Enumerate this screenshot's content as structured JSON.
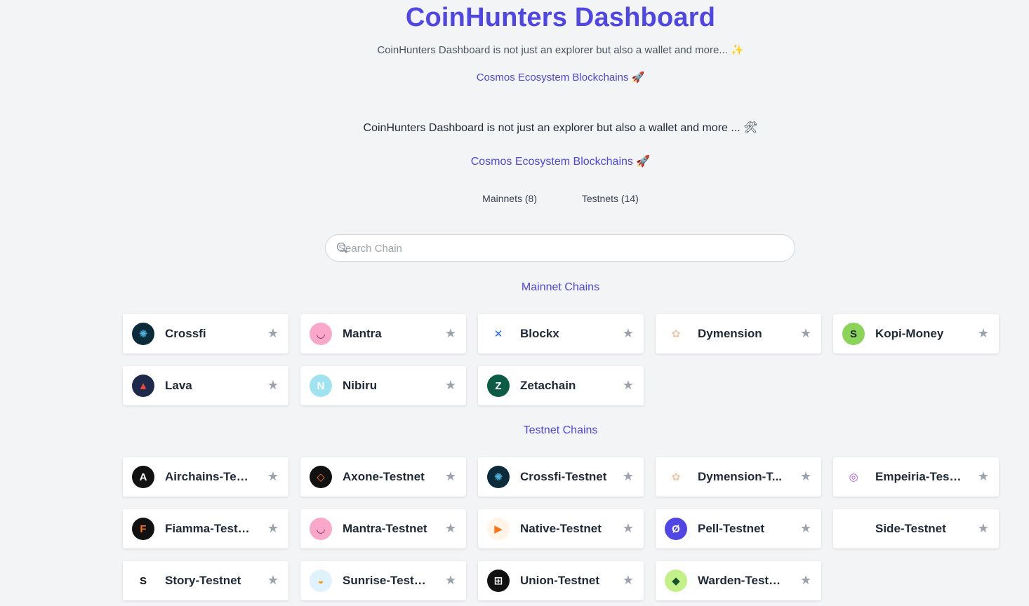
{
  "header": {
    "title": "CoinHunters Dashboard",
    "subtitle": "CoinHunters Dashboard is not just an explorer but also a wallet and more... ✨",
    "ecosystem_link": "Cosmos Ecosystem Blockchains 🚀",
    "subtitle2": "CoinHunters Dashboard is not just an explorer but also a wallet and more ... 🛠",
    "ecosystem_link2": "Cosmos Ecosystem Blockchains 🚀"
  },
  "tabs": {
    "mainnets": "Mainnets (8)",
    "testnets": "Testnets (14)"
  },
  "search": {
    "placeholder": "Search Chain"
  },
  "mainnet_section": {
    "label": "Mainnet Chains",
    "chains": [
      {
        "name": "Crossfi",
        "logo_color": "#0b2a3a",
        "logo_text": "✺",
        "logo_fg": "#4fb3d9"
      },
      {
        "name": "Mantra",
        "logo_color": "#f9a8c9",
        "logo_text": "◡",
        "logo_fg": "#7c2d5a"
      },
      {
        "name": "Blockx",
        "logo_color": "#ffffff",
        "logo_text": "✕",
        "logo_fg": "#2563eb"
      },
      {
        "name": "Dymension",
        "logo_color": "#ffffff",
        "logo_text": "✿",
        "logo_fg": "#f0c8a8"
      },
      {
        "name": "Kopi-Money",
        "logo_color": "#8bd45a",
        "logo_text": "S",
        "logo_fg": "#1f2937"
      },
      {
        "name": "Lava",
        "logo_color": "#1e2a4a",
        "logo_text": "▲",
        "logo_fg": "#ef4444"
      },
      {
        "name": "Nibiru",
        "logo_color": "#9fe3f0",
        "logo_text": "N",
        "logo_fg": "#ffffff"
      },
      {
        "name": "Zetachain",
        "logo_color": "#0c5b45",
        "logo_text": "Z",
        "logo_fg": "#ffffff"
      }
    ]
  },
  "testnet_section": {
    "label": "Testnet Chains",
    "chains": [
      {
        "name": "Airchains-Testnet",
        "display": "Airchains-Tes...",
        "logo_color": "#111111",
        "logo_text": "A",
        "logo_fg": "#ffffff"
      },
      {
        "name": "Axone-Testnet",
        "display": "Axone-Testnet",
        "logo_color": "#111111",
        "logo_text": "◇",
        "logo_fg": "#f97316"
      },
      {
        "name": "Crossfi-Testnet",
        "display": "Crossfi-Testnet",
        "logo_color": "#0b2a3a",
        "logo_text": "✺",
        "logo_fg": "#4fb3d9"
      },
      {
        "name": "Dymension-Testnet",
        "display": "Dymension-T...",
        "logo_color": "#ffffff",
        "logo_text": "✿",
        "logo_fg": "#f0c8a8"
      },
      {
        "name": "Empeiria-Testnet",
        "display": "Empeiria-Test...",
        "logo_color": "#ffffff",
        "logo_text": "◎",
        "logo_fg": "#a855f7"
      },
      {
        "name": "Fiamma-Testnet",
        "display": "Fiamma-Testnet",
        "logo_color": "#111111",
        "logo_text": "F",
        "logo_fg": "#f97316"
      },
      {
        "name": "Mantra-Testnet",
        "display": "Mantra-Testnet",
        "logo_color": "#f9a8c9",
        "logo_text": "◡",
        "logo_fg": "#7c2d5a"
      },
      {
        "name": "Native-Testnet",
        "display": "Native-Testnet",
        "logo_color": "#fff4e6",
        "logo_text": "▶",
        "logo_fg": "#f97316"
      },
      {
        "name": "Pell-Testnet",
        "display": "Pell-Testnet",
        "logo_color": "#4f46e5",
        "logo_text": "Ø",
        "logo_fg": "#ffffff"
      },
      {
        "name": "Side-Testnet",
        "display": "Side-Testnet",
        "logo_color": "#ffffff",
        "logo_text": "",
        "logo_fg": "#9ca3af"
      },
      {
        "name": "Story-Testnet",
        "display": "Story-Testnet",
        "logo_color": "#ffffff",
        "logo_text": "S",
        "logo_fg": "#111111"
      },
      {
        "name": "Sunrise-Testnet",
        "display": "Sunrise-Testnet",
        "logo_color": "#e0f2fe",
        "logo_text": "◒",
        "logo_fg": "#f59e0b"
      },
      {
        "name": "Union-Testnet",
        "display": "Union-Testnet",
        "logo_color": "#111111",
        "logo_text": "⊞",
        "logo_fg": "#ffffff"
      },
      {
        "name": "Warden-Testnet",
        "display": "Warden-Testnet",
        "logo_color": "#c4f08a",
        "logo_text": "◆",
        "logo_fg": "#14532d"
      }
    ]
  },
  "icons": {
    "favorite": "star-icon",
    "search": "search-icon"
  },
  "colors": {
    "accent": "#4f46e5",
    "background": "#f3f4f6",
    "star": "#9ca3af"
  }
}
